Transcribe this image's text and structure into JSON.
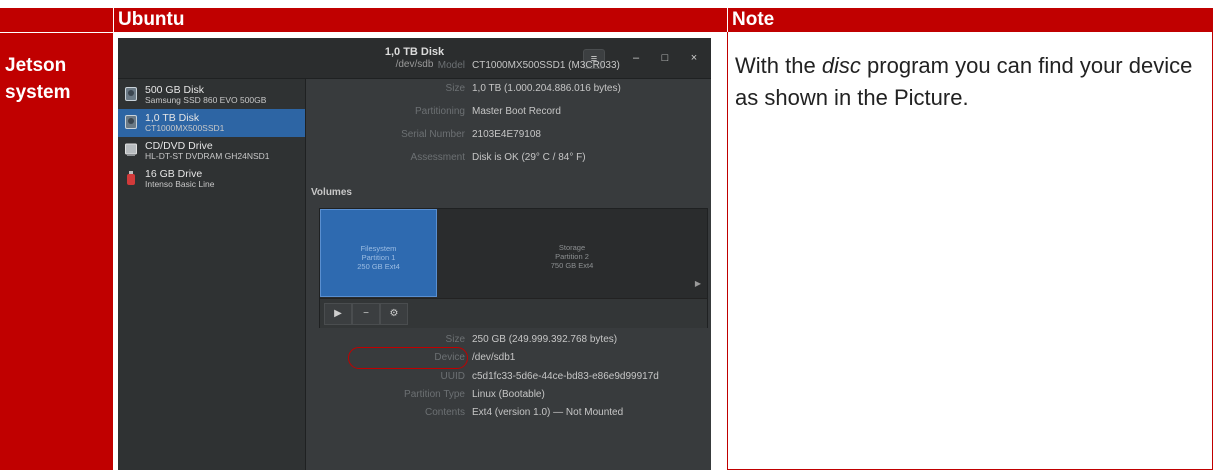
{
  "table": {
    "header_ubuntu": "Ubuntu",
    "header_note": "Note",
    "row_label_line1": "Jetson",
    "row_label_line2": "system"
  },
  "note": {
    "part1": "With the ",
    "emphasis": "disc",
    "part2": " program you can find your device as shown in the Picture."
  },
  "window": {
    "title": "1,0 TB Disk",
    "subtitle": "/dev/sdb",
    "menu_icon": "≡",
    "minimize_icon": "–",
    "maximize_icon": "□",
    "close_icon": "×"
  },
  "drives": [
    {
      "name": "500 GB Disk",
      "model": "Samsung SSD 860 EVO 500GB",
      "icon": "hdd-icon"
    },
    {
      "name": "1,0 TB Disk",
      "model": "CT1000MX500SSD1",
      "icon": "hdd-icon"
    },
    {
      "name": "CD/DVD Drive",
      "model": "HL-DT-ST DVDRAM GH24NSD1",
      "icon": "optical-drive-icon"
    },
    {
      "name": "16 GB Drive",
      "model": "Intenso Basic Line",
      "icon": "usb-drive-icon"
    }
  ],
  "disk_props": [
    {
      "key": "Model",
      "value": "CT1000MX500SSD1 (M3CR033)"
    },
    {
      "key": "Size",
      "value": "1,0 TB (1.000.204.886.016 bytes)"
    },
    {
      "key": "Partitioning",
      "value": "Master Boot Record"
    },
    {
      "key": "Serial Number",
      "value": "2103E4E79108"
    },
    {
      "key": "Assessment",
      "value": "Disk is OK (29° C / 84° F)"
    }
  ],
  "volumes": {
    "heading": "Volumes",
    "partitions": [
      {
        "line1": "Filesystem",
        "line2": "Partition 1",
        "line3": "250 GB Ext4"
      },
      {
        "line1": "Storage",
        "line2": "Partition 2",
        "line3": "750 GB Ext4"
      }
    ],
    "tool_play": "▶",
    "tool_minus": "−",
    "tool_gears": "⚙"
  },
  "volume_props": [
    {
      "key": "Size",
      "value": "250 GB (249.999.392.768 bytes)"
    },
    {
      "key": "Device",
      "value": "/dev/sdb1"
    },
    {
      "key": "UUID",
      "value": "c5d1fc33-5d6e-44ce-bd83-e86e9d99917d"
    },
    {
      "key": "Partition Type",
      "value": "Linux (Bootable)"
    },
    {
      "key": "Contents",
      "value": "Ext4 (version 1.0) — Not Mounted"
    }
  ],
  "colors": {
    "accent_red": "#c00000",
    "selection_blue": "#2d65a4"
  }
}
